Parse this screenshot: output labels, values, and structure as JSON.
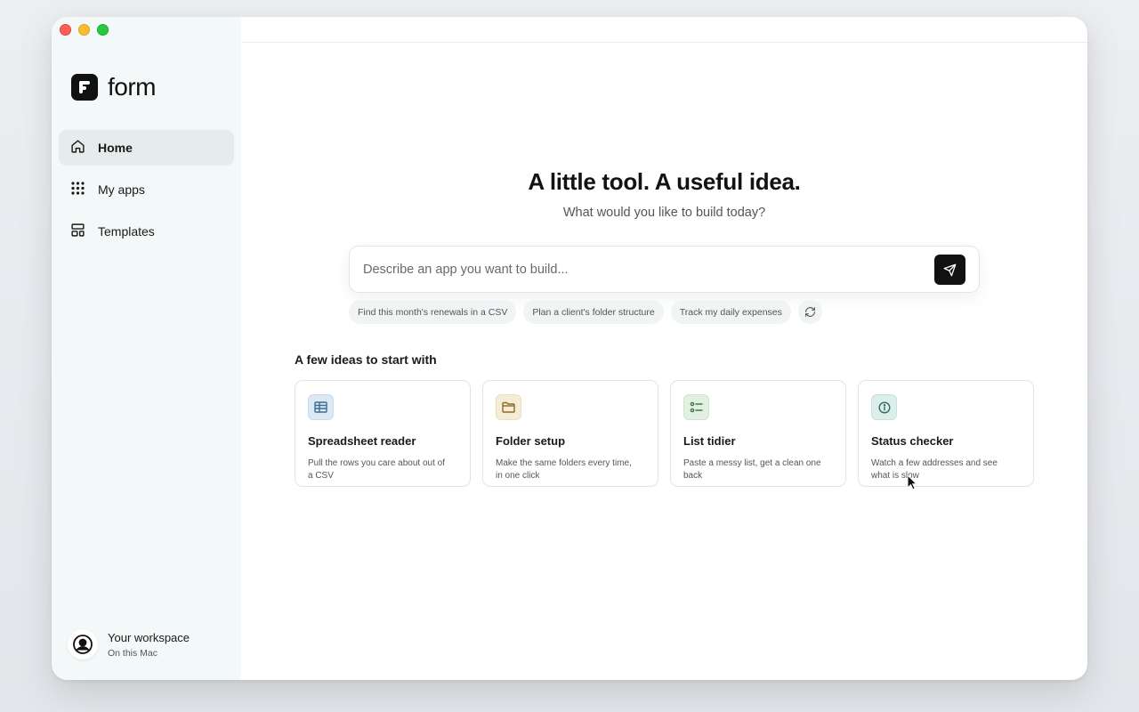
{
  "app": {
    "name": "form"
  },
  "nav": {
    "items": [
      {
        "label": "Home",
        "icon": "home-icon",
        "active": true
      },
      {
        "label": "My apps",
        "icon": "grid-icon",
        "active": false
      },
      {
        "label": "Templates",
        "icon": "templates-icon",
        "active": false
      }
    ]
  },
  "workspace": {
    "name": "Your workspace",
    "location": "On this Mac"
  },
  "hero": {
    "title": "A little tool. A useful idea.",
    "subtitle": "What would you like to build today?"
  },
  "prompt": {
    "placeholder": "Describe an app you want to build...",
    "value": ""
  },
  "suggestions": [
    "Find this month's renewals in a CSV",
    "Plan a client's folder structure",
    "Track my daily expenses"
  ],
  "ideas": {
    "heading": "A few ideas to start with",
    "cards": [
      {
        "title": "Spreadsheet reader",
        "description": "Pull the rows you care about out of a CSV",
        "icon": "table-icon",
        "color": "#dce9f3",
        "icon_color": "#3d6e8f"
      },
      {
        "title": "Folder setup",
        "description": "Make the same folders every time, in one click",
        "icon": "folder-icon",
        "color": "#f5ecd6",
        "icon_color": "#8a6a2a"
      },
      {
        "title": "List tidier",
        "description": "Paste a messy list, get a clean one back",
        "icon": "checklist-icon",
        "color": "#e1f0e1",
        "icon_color": "#3e7a45"
      },
      {
        "title": "Status checker",
        "description": "Watch a few addresses and see what is slow",
        "icon": "info-icon",
        "color": "#dceeea",
        "icon_color": "#2f6b5e"
      }
    ]
  }
}
